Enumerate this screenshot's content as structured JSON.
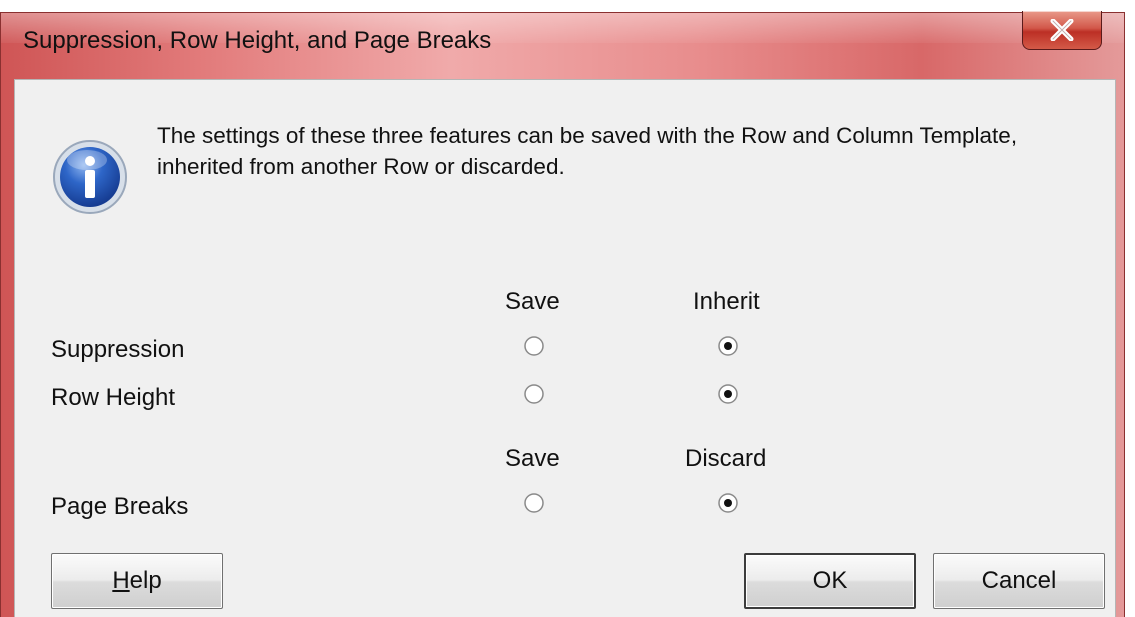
{
  "window": {
    "title": "Suppression, Row Height, and Page Breaks",
    "close_glyph": "X",
    "icon": "close-icon"
  },
  "message": {
    "icon": "info-icon",
    "text": "The settings of these three features can be saved with the Row and Column Template, inherited from another Row or discarded."
  },
  "group1": {
    "columns": [
      "Save",
      "Inherit"
    ],
    "rows": [
      {
        "label": "Suppression",
        "selected": "Inherit"
      },
      {
        "label": "Row Height",
        "selected": "Inherit"
      }
    ]
  },
  "group2": {
    "columns": [
      "Save",
      "Discard"
    ],
    "rows": [
      {
        "label": "Page Breaks",
        "selected": "Discard"
      }
    ]
  },
  "buttons": {
    "help": {
      "mnemonic": "H",
      "rest": "elp"
    },
    "ok": "OK",
    "cancel": "Cancel"
  }
}
